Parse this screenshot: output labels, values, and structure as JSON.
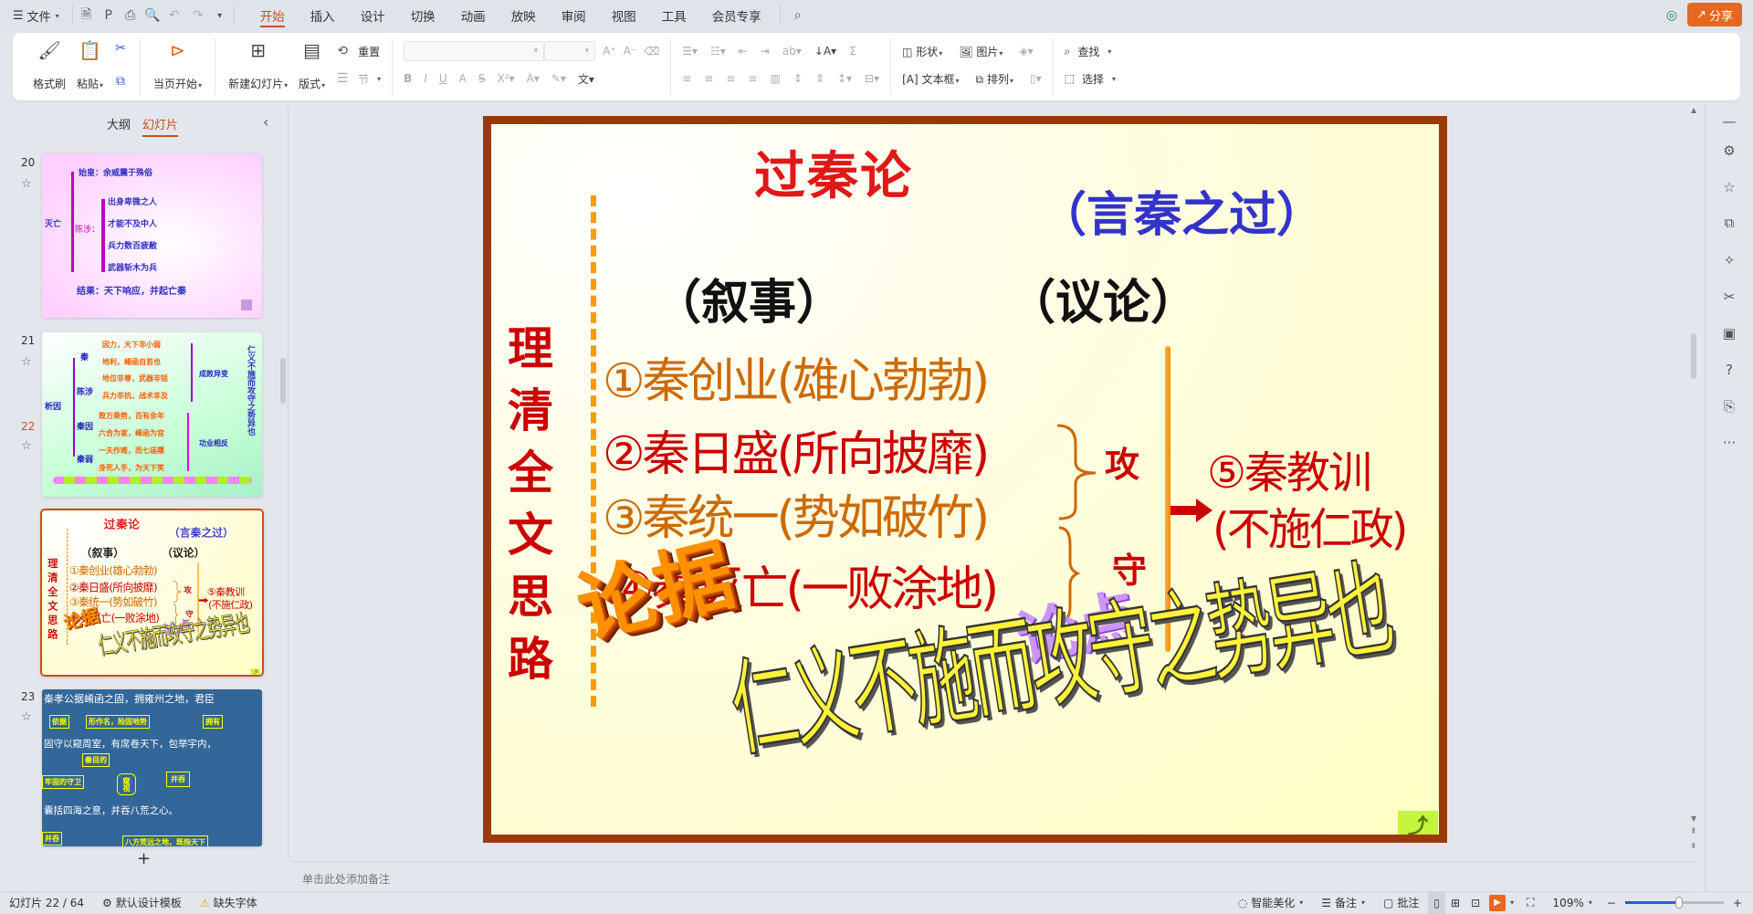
{
  "titlebar": {
    "menu": "文件",
    "tabs": [
      "开始",
      "插入",
      "设计",
      "切换",
      "动画",
      "放映",
      "审阅",
      "视图",
      "工具",
      "会员专享"
    ],
    "active_tab": "开始",
    "share": "分享"
  },
  "ribbon": {
    "format_painter": "格式刷",
    "paste": "粘贴",
    "play_from_current": "当页开始",
    "new_slide": "新建幻灯片",
    "layout": "版式",
    "reset": "重置",
    "section": "节",
    "shape": "形状",
    "picture": "图片",
    "textbox": "文本框",
    "arrange": "排列",
    "find": "查找",
    "select": "选择",
    "font_name": "",
    "font_size": ""
  },
  "left_panel": {
    "tab_outline": "大纲",
    "tab_slides": "幻灯片",
    "add_slide": "+",
    "slides": [
      {
        "num": "20",
        "texts": {
          "a": "始皇：余威震于殊俗",
          "b": "灭亡",
          "c": "陈涉：",
          "d": "出身卑微之人",
          "e": "才能不及中人",
          "f": "兵力数百疲敝",
          "g": "武器斩木为兵",
          "h": "结果：天下响应，并起亡秦"
        }
      },
      {
        "num": "21",
        "texts": {
          "a": "析因",
          "b": "秦",
          "c": "陈涉",
          "d": "秦因",
          "e": "秦弱",
          "f": "因力，天下非小弱",
          "g": "地利，崤函自若也",
          "h": "地位非尊，武器非铦",
          "i": "兵力非抗，战术非及",
          "j": "致万乘势，百有余年",
          "k": "六合为家，崤函为宫",
          "l": "一夫作难，而七庙隳",
          "m": "身死人手，为天下笑",
          "n": "成败异变",
          "o": "功业相反",
          "p": "仁义不施而攻守之势异也"
        }
      },
      {
        "num": "22"
      },
      {
        "num": "23",
        "texts": {
          "a": "秦孝公据崤函之固，拥雍州之地，君臣",
          "b": "依据",
          "c": "形作名，险固地势",
          "d": "拥有",
          "e": "固守以窥周室，有席卷天下，包举宇内，",
          "f": "秦目的",
          "g": "牢固的守卫",
          "h": "窥视",
          "i": "并吞",
          "j": "囊括四海之意，并吞八荒之心。",
          "k": "并吞",
          "l": "八方荒远之地，既指天下"
        }
      }
    ]
  },
  "slide": {
    "title": "过秦论",
    "subtitle": "（言秦之过）",
    "narrative": "（叙事）",
    "argument": "（议论）",
    "vertical": [
      "理",
      "清",
      "全",
      "文",
      "思",
      "路"
    ],
    "items": [
      "①秦创业(雄心勃勃)",
      "②秦日盛(所向披靡)",
      "③秦统一(势如破竹)",
      "④秦灭亡(一败涂地)"
    ],
    "attack": "攻",
    "defend": "守",
    "lesson1": "⑤秦教训",
    "lesson2": "(不施仁政)",
    "point_label": "论点",
    "evidence_label": "论据",
    "thesis": "仁义不施而攻守之势异也",
    "colors": {
      "border": "#9a3a0a",
      "title": "#e01818",
      "subtitle": "#3333cc",
      "orange": "#cc6a00",
      "red": "#cc0000"
    }
  },
  "notes": {
    "placeholder": "单击此处添加备注"
  },
  "status": {
    "slide_counter": "幻灯片 22 / 64",
    "template": "默认设计模板",
    "missing_font": "缺失字体",
    "beautify": "智能美化",
    "notes": "备注",
    "comments": "批注",
    "zoom": "109%",
    "zoom_fraction": 0.55
  }
}
